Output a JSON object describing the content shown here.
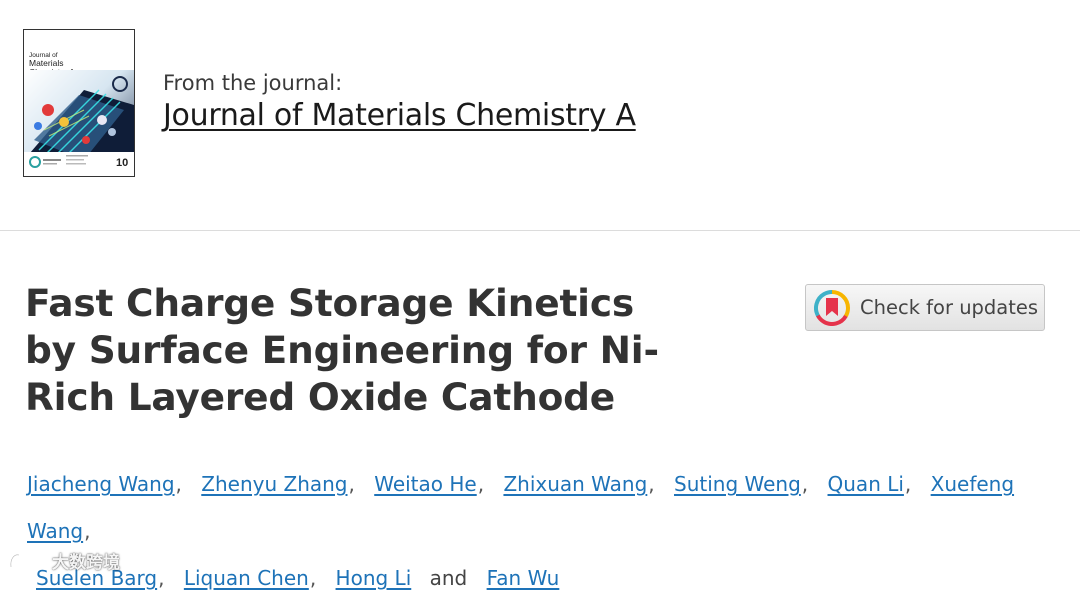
{
  "journal_header": {
    "cover_title_line1": "Journal of",
    "cover_title_line2": "Materials Chemistry A",
    "from_label": "From the journal:",
    "journal_name": "Journal of Materials Chemistry A"
  },
  "article": {
    "title": "Fast Charge Storage Kinetics by Surface Engineering for Ni-Rich Layered Oxide Cathode",
    "check_updates_label": "Check for updates"
  },
  "authors": {
    "line1": [
      "Jiacheng Wang",
      "Zhenyu Zhang",
      "Weitao He",
      "Zhixuan Wang",
      "Suting Weng",
      "Quan Li",
      "Xuefeng Wang"
    ],
    "line2_before_and": [
      "Suelen Barg",
      "Liquan Chen",
      "Hong Li"
    ],
    "conjunction": "and",
    "last": "Fan Wu",
    "separator": ","
  },
  "watermark": {
    "text": "大数跨境"
  },
  "colors": {
    "link": "#1e73b8",
    "title": "#333333",
    "divider": "#dcdcdc"
  }
}
